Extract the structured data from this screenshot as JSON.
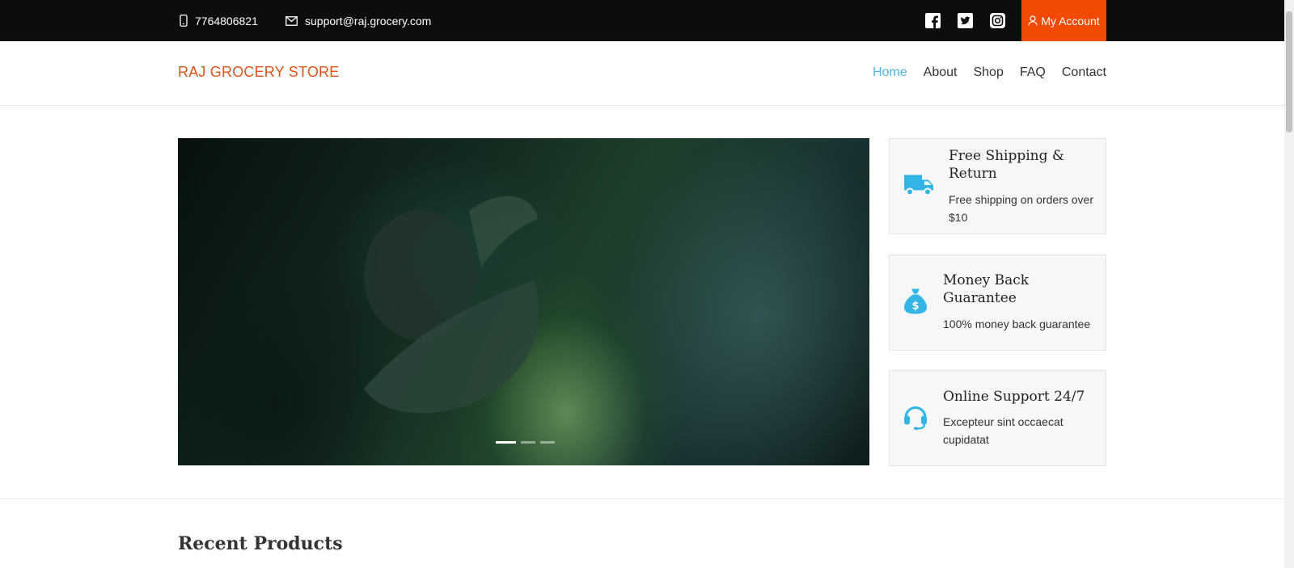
{
  "topbar": {
    "phone": "7764806821",
    "email": "support@raj.grocery.com",
    "social": [
      "facebook-icon",
      "twitter-icon",
      "instagram-icon"
    ],
    "account_label": "My Account",
    "account_color": "#f24a05"
  },
  "header": {
    "logo": "RAJ GROCERY STORE",
    "nav": [
      "Home",
      "About",
      "Shop",
      "FAQ",
      "Contact"
    ],
    "active_nav": "Home",
    "accent": "#4fb5dc"
  },
  "hero": {
    "slides": 3,
    "active_slide": 1
  },
  "features": [
    {
      "icon": "truck-icon",
      "title": "Free Shipping & Return",
      "text": "Free shipping on orders over $10"
    },
    {
      "icon": "money-bag-icon",
      "title": "Money Back Guarantee",
      "text": "100% money back guarantee"
    },
    {
      "icon": "headset-icon",
      "title": "Online Support 24/7",
      "text": "Excepteur sint occaecat cupidatat"
    }
  ],
  "sections": {
    "recent_products_title": "Recent Products"
  }
}
